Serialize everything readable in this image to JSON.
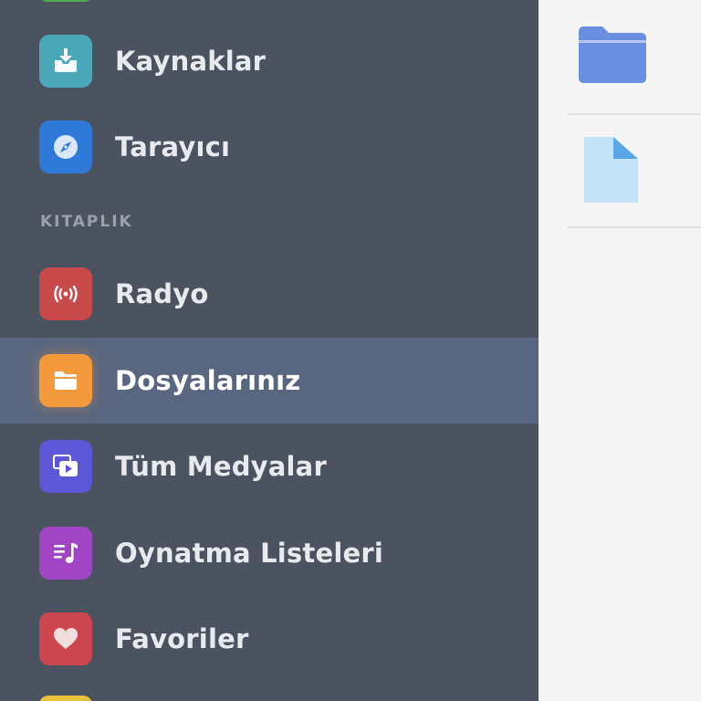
{
  "sidebar": {
    "items": [
      {
        "label": "Kaynaklar",
        "icon": "download-tray-icon",
        "color": "#4aa8b8"
      },
      {
        "label": "Tarayıcı",
        "icon": "compass-icon",
        "color": "#2f7ad8"
      },
      {
        "label": "Radyo",
        "icon": "broadcast-icon",
        "color": "#c94a4a"
      },
      {
        "label": "Dosyalarınız",
        "icon": "folder-icon",
        "color": "#f29a3c",
        "active": true
      },
      {
        "label": "Tüm Medyalar",
        "icon": "media-play-icon",
        "color": "#5b57d6"
      },
      {
        "label": "Oynatma Listeleri",
        "icon": "playlist-icon",
        "color": "#a245c4"
      },
      {
        "label": "Favoriler",
        "icon": "heart-icon",
        "color": "#cc4650"
      }
    ],
    "section_title": "KITAPLIK",
    "background": "#4b5360",
    "active_background": "#59667f"
  },
  "content": {
    "rows": [
      {
        "icon": "folder-icon",
        "color": "#6b8fe0"
      },
      {
        "icon": "file-icon",
        "color": "#c5e3f6"
      }
    ]
  }
}
